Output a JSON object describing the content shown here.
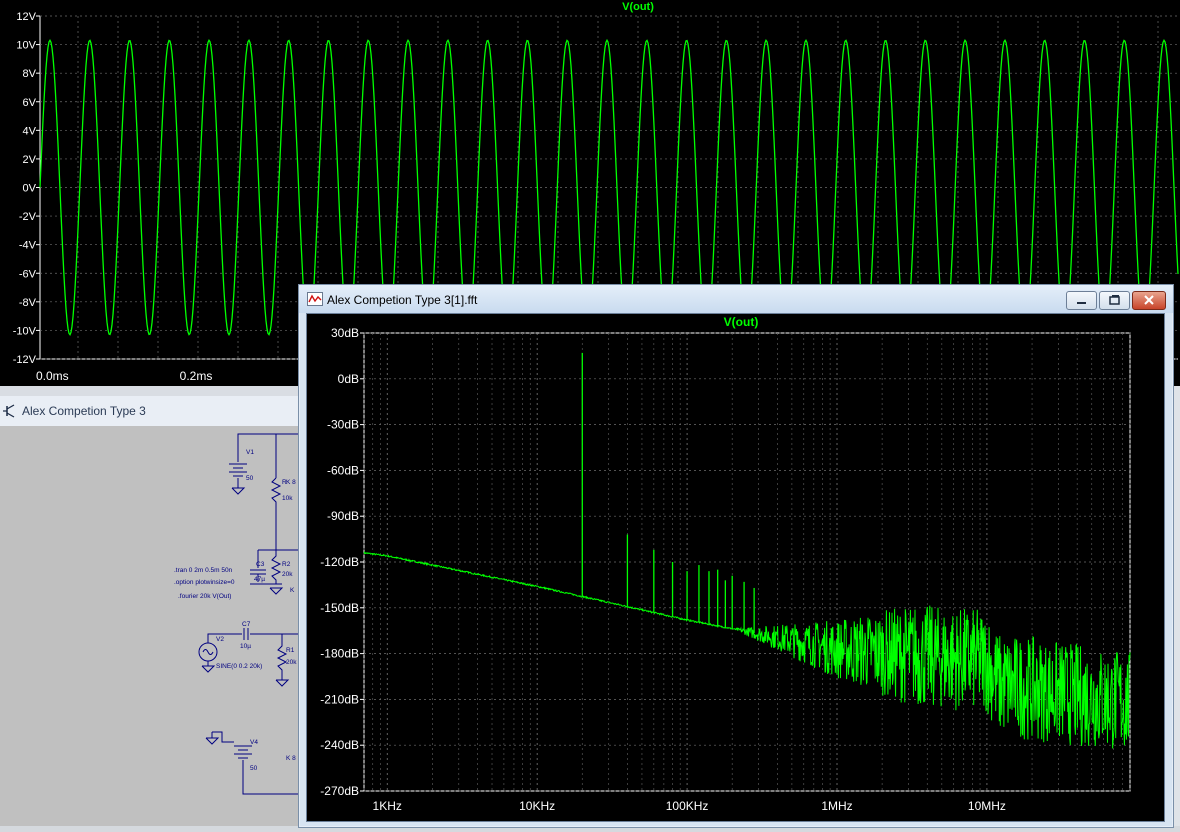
{
  "colors": {
    "trace": "#00ff00",
    "background": "#000000",
    "axis_text": "#ffffff",
    "grid": "#707070"
  },
  "waveform_window": {
    "chart_data": {
      "type": "line",
      "title": "V(out)",
      "series": [
        {
          "name": "V(out)",
          "shape": "sine",
          "amplitude": 10.3,
          "offset": 0,
          "cycles_visible": 28.6
        }
      ],
      "ylim": [
        -12,
        12
      ],
      "y_ticks": [
        "12V",
        "10V",
        "8V",
        "6V",
        "4V",
        "2V",
        "0V",
        "-2V",
        "-4V",
        "-6V",
        "-8V",
        "-10V",
        "-12V"
      ],
      "x_ticks": [
        "0.0ms",
        "0.2ms"
      ],
      "x_tick_partial": "s",
      "grid": true
    }
  },
  "schematic_window": {
    "title": "Alex Competion Type 3",
    "icon": "transistor-icon",
    "labels": {
      "v1": "V1",
      "v1_val": "50",
      "r3_name": "R",
      "r3_val": "10k",
      "k_top": "K 8",
      "c3": "C3",
      "c3_val": "47µ",
      "r2": "R2",
      "r2_val": "20k",
      "k_mid": "K",
      "tran": ".tran 0 2m 0.5m 50n",
      "option": ".option plotwinsize=0",
      "fourier": ".fourier 20k V(Out)",
      "c7": "C7",
      "c7_val": "10µ",
      "v2": "V2",
      "v2_val": "SINE(0 0.2 20k)",
      "r1": "R1",
      "r1_val": "20k",
      "v4": "V4",
      "v4_val": "50",
      "k_bot": "K 8"
    }
  },
  "fft_window": {
    "title": "Alex Competion Type 3[1].fft",
    "icon": "waveform-icon",
    "buttons": {
      "minimize": "minimize",
      "maximize": "maximize",
      "close": "close"
    },
    "chart_data": {
      "type": "line",
      "title": "V(out)",
      "x_scale": "log",
      "xlim": [
        700,
        90000000
      ],
      "ylim": [
        -270,
        30
      ],
      "y_ticks": [
        "30dB",
        "0dB",
        "-30dB",
        "-60dB",
        "-90dB",
        "-120dB",
        "-150dB",
        "-180dB",
        "-210dB",
        "-240dB",
        "-270dB"
      ],
      "y_tick_values": [
        30,
        0,
        -30,
        -60,
        -90,
        -120,
        -150,
        -180,
        -210,
        -240,
        -270
      ],
      "x_ticks": [
        "1KHz",
        "10KHz",
        "100KHz",
        "1MHz",
        "10MHz"
      ],
      "x_tick_values": [
        1000,
        10000,
        100000,
        1000000,
        10000000
      ],
      "grid": true,
      "noise_floor": [
        {
          "f": 700,
          "db": -114
        },
        {
          "f": 1000,
          "db": -116
        },
        {
          "f": 10000,
          "db": -136
        },
        {
          "f": 100000,
          "db": -158
        },
        {
          "f": 1000000,
          "db": -177
        },
        {
          "f": 10000000,
          "db": -185
        },
        {
          "f": 12000000,
          "db": -200
        },
        {
          "f": 90000000,
          "db": -212
        }
      ],
      "harmonics": [
        {
          "f": 20000,
          "db": 17
        },
        {
          "f": 40000,
          "db": -102
        },
        {
          "f": 60000,
          "db": -112
        },
        {
          "f": 80000,
          "db": -120
        },
        {
          "f": 100000,
          "db": -126
        },
        {
          "f": 120000,
          "db": -122
        },
        {
          "f": 140000,
          "db": -126
        },
        {
          "f": 160000,
          "db": -125
        },
        {
          "f": 180000,
          "db": -132
        },
        {
          "f": 200000,
          "db": -129
        },
        {
          "f": 240000,
          "db": -133
        },
        {
          "f": 280000,
          "db": -137
        }
      ]
    }
  }
}
